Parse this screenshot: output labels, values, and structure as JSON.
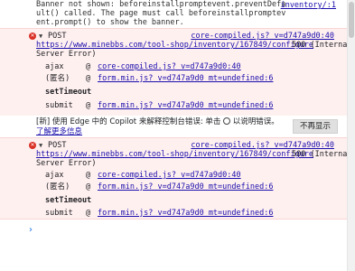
{
  "banner": {
    "text": "Banner not shown: beforeinstallpromptevent.preventDefault() called. The page must call beforeinstallpromptevent.prompt() to show the banner.",
    "source": "inventory/:1"
  },
  "errors": [
    {
      "method": "POST",
      "source": "core-compiled.js?_v=d747a9d0:40",
      "url": "https://www.minebbs.com/tool-shop/inventory/167849/configure",
      "status": "500 (Internal Server Error)",
      "stack": [
        {
          "fn": "ajax",
          "at": "@",
          "src": "core-compiled.js?_v=d747a9d0:40"
        },
        {
          "fn": "(匿名)",
          "at": "@",
          "src": "form.min.js?_v=d747a9d0_mt=undefined:6"
        },
        {
          "fn": "setTimeout",
          "at": "",
          "src": ""
        },
        {
          "fn": "submit",
          "at": "@",
          "src": "form.min.js?_v=d747a9d0_mt=undefined:6"
        }
      ]
    },
    {
      "method": "POST",
      "source": "core-compiled.js?_v=d747a9d0:40",
      "url": "https://www.minebbs.com/tool-shop/inventory/167849/configure",
      "status": "500 (Internal Server Error)",
      "stack": [
        {
          "fn": "ajax",
          "at": "@",
          "src": "core-compiled.js?_v=d747a9d0:40"
        },
        {
          "fn": "(匿名)",
          "at": "@",
          "src": "form.min.js?_v=d747a9d0_mt=undefined:6"
        },
        {
          "fn": "setTimeout",
          "at": "",
          "src": ""
        },
        {
          "fn": "submit",
          "at": "@",
          "src": "form.min.js?_v=d747a9d0_mt=undefined:6"
        }
      ]
    }
  ],
  "copilot": {
    "text": "[新] 使用 Edge 中的 Copilot 来解释控制台错误: 单击",
    "text2": "以说明错误。",
    "link": "了解更多信息",
    "dismiss": "不再显示"
  },
  "prompt": {
    "glyph": "›"
  },
  "icons": {
    "error": "error-circle-icon",
    "expand": "triangle-down-icon",
    "bulb": "lightbulb-icon"
  },
  "colors": {
    "error_bg": "#fff0f0",
    "link": "#1a0dab",
    "error_icon": "#d93025"
  }
}
